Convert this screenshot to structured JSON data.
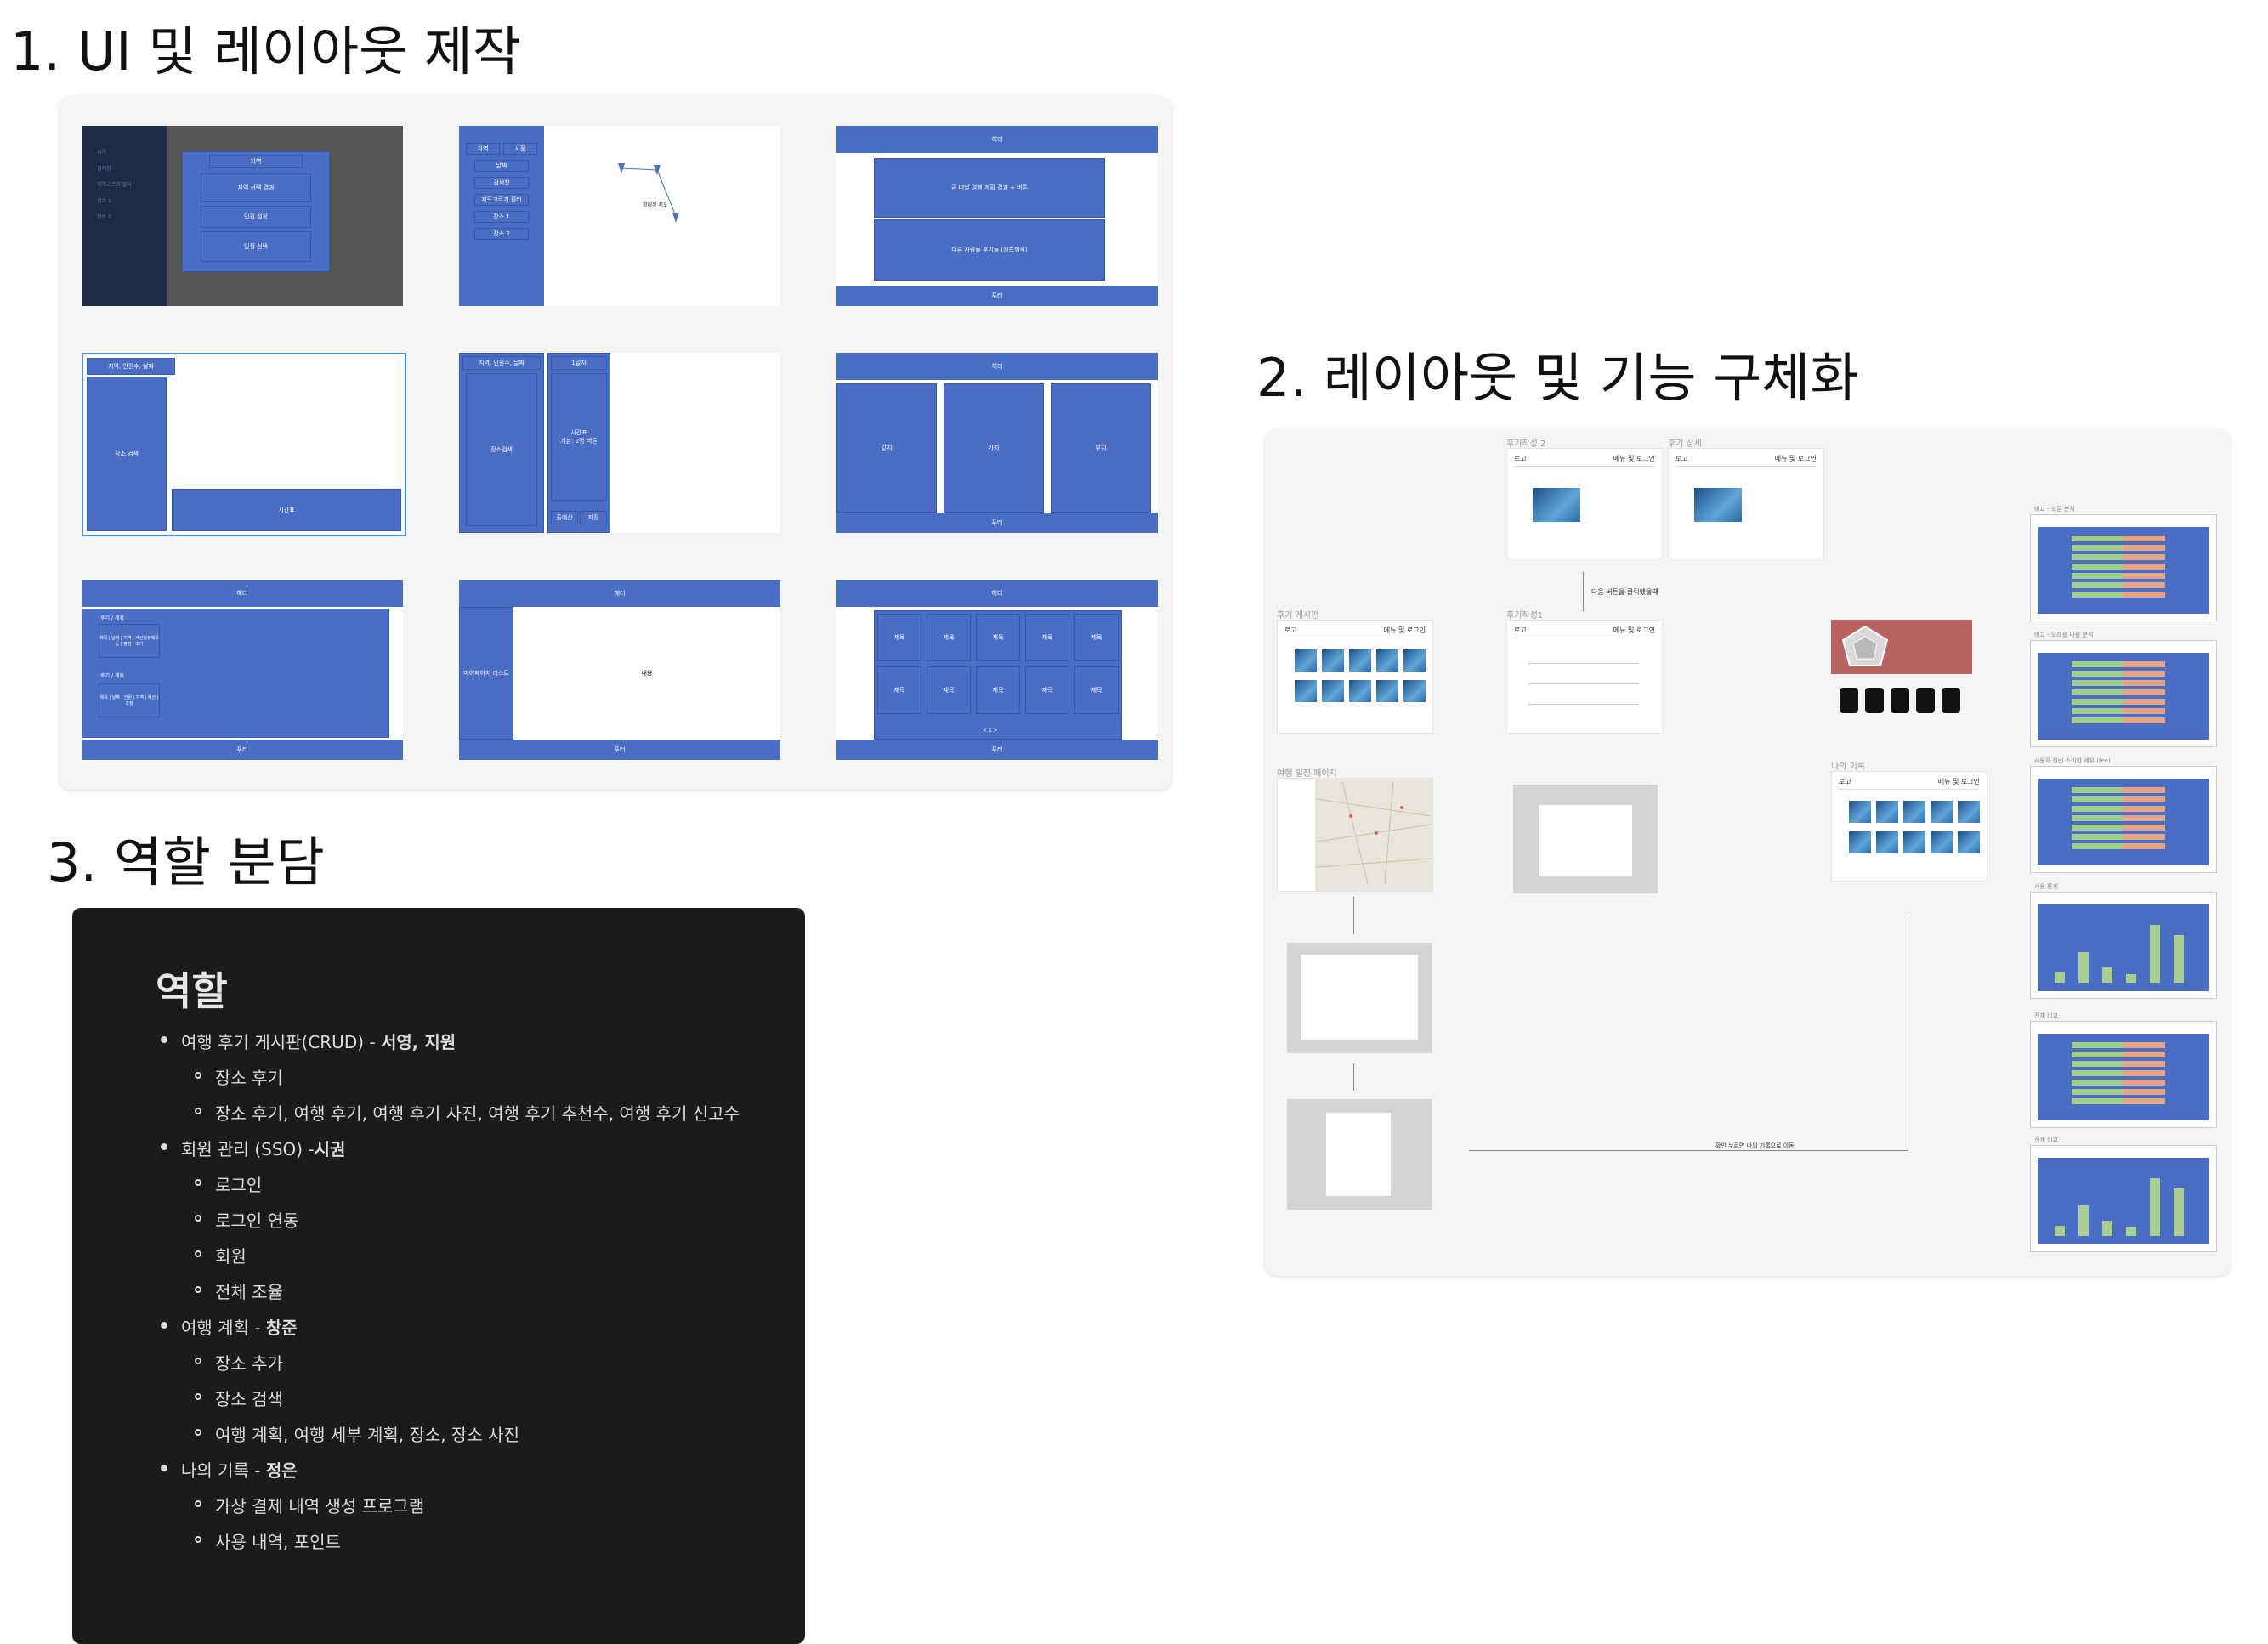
{
  "sections": {
    "ui_layout_title": "1. UI 및 레이아웃 제작",
    "detail_title": "2. 레이아웃 및 기능 구체화",
    "roles_title": "3. 역할 분담"
  },
  "wireframes": {
    "f1": {
      "menu": [
        "지역",
        "날짜",
        "검색창",
        "지역고르기 필터",
        "장소 1",
        "장소 2"
      ],
      "modal": [
        "지역",
        "지역 선택 결과",
        "인원 설정",
        "일정 선택"
      ]
    },
    "f2": {
      "side": [
        "지역",
        "시점",
        "날짜",
        "검색창",
        "지도고르기 필터",
        "장소 1",
        "장소 2"
      ],
      "map_label": "확대된 지도"
    },
    "f3": {
      "header": "헤더",
      "box1": "곧 떠날 여행 계획 결과 + 버튼",
      "box2": "다른 사람들 후기들 (카드형식)",
      "footer": "푸터"
    },
    "f4": {
      "top": "지역, 인원수, 날짜",
      "left": "장소 검색",
      "bottom": "시간표"
    },
    "f5": {
      "top": "지역, 인원수, 날짜",
      "left": "장소검색",
      "col_top": "1일차",
      "col_mid": "시간표",
      "col_mid2": "기본: 2명 버튼",
      "b1": "출예산",
      "b2": "저장"
    },
    "f6": {
      "header": "헤더",
      "cols": [
        "같지",
        "가지",
        "부지"
      ],
      "footer": "푸터"
    },
    "f7": {
      "header": "헤더",
      "row1_title": "후기 / 계획",
      "row1_text": "제목 | 날짜 | 지역 | 계인일정제목들 | 평점 | 조기",
      "row2_title": "후기 / 계획",
      "row2_text": "제목 | 날짜 | 인원 | 지역 | 예산 | 조정",
      "footer": "푸터"
    },
    "f8": {
      "header": "헤더",
      "side": "마이페이지 리스트",
      "content": "내용",
      "footer": "푸터"
    },
    "f9": {
      "header": "헤더",
      "cell": "제목",
      "pager": "< 1 >",
      "footer": "푸터"
    }
  },
  "detail": {
    "review_write2": "후기작성 2",
    "review_detail": "후기 상세",
    "review_board": "후기 게시판",
    "review_write1": "후기작성1",
    "travel_plan": "여행 일정 페이지",
    "my_records": "나의 기록",
    "logo": "로고",
    "menu_login": "메뉴 및 로그인",
    "next_button_note": "다음 버튼을 클릭했을때",
    "bottom_note": "확인 누르면 나의 기록으로 이동",
    "chart_labels": [
      "비교 - 오른 분석",
      "비교 - 오래를 나를 분석",
      "사용자 최빈 소비한 세부 (fee)",
      "사용 통계",
      "전체 비교",
      "전체 비교"
    ]
  },
  "roles": {
    "heading": "역할",
    "items": [
      {
        "level": 1,
        "text": "여행 후기 게시판(CRUD) - ",
        "bold": "서영, 지원"
      },
      {
        "level": 2,
        "text": "장소 후기",
        "bold": ""
      },
      {
        "level": 2,
        "text": "장소 후기, 여행 후기, 여행 후기 사진, 여행 후기 추천수, 여행 후기 신고수",
        "bold": ""
      },
      {
        "level": 1,
        "text": "회원 관리 (SSO) -",
        "bold": "시권"
      },
      {
        "level": 2,
        "text": "로그인",
        "bold": ""
      },
      {
        "level": 2,
        "text": "로그인 연동",
        "bold": ""
      },
      {
        "level": 2,
        "text": "회원",
        "bold": ""
      },
      {
        "level": 2,
        "text": "전체 조율",
        "bold": ""
      },
      {
        "level": 1,
        "text": "여행 계획 - ",
        "bold": "창준"
      },
      {
        "level": 2,
        "text": "장소 추가",
        "bold": ""
      },
      {
        "level": 2,
        "text": "장소 검색",
        "bold": ""
      },
      {
        "level": 2,
        "text": "여행 계획, 여행 세부 계획, 장소, 장소 사진",
        "bold": ""
      },
      {
        "level": 1,
        "text": "나의 기록 - ",
        "bold": "정은"
      },
      {
        "level": 2,
        "text": "가상 결제 내역 생성 프로그램",
        "bold": ""
      },
      {
        "level": 2,
        "text": "사용 내역, 포인트",
        "bold": ""
      }
    ]
  }
}
